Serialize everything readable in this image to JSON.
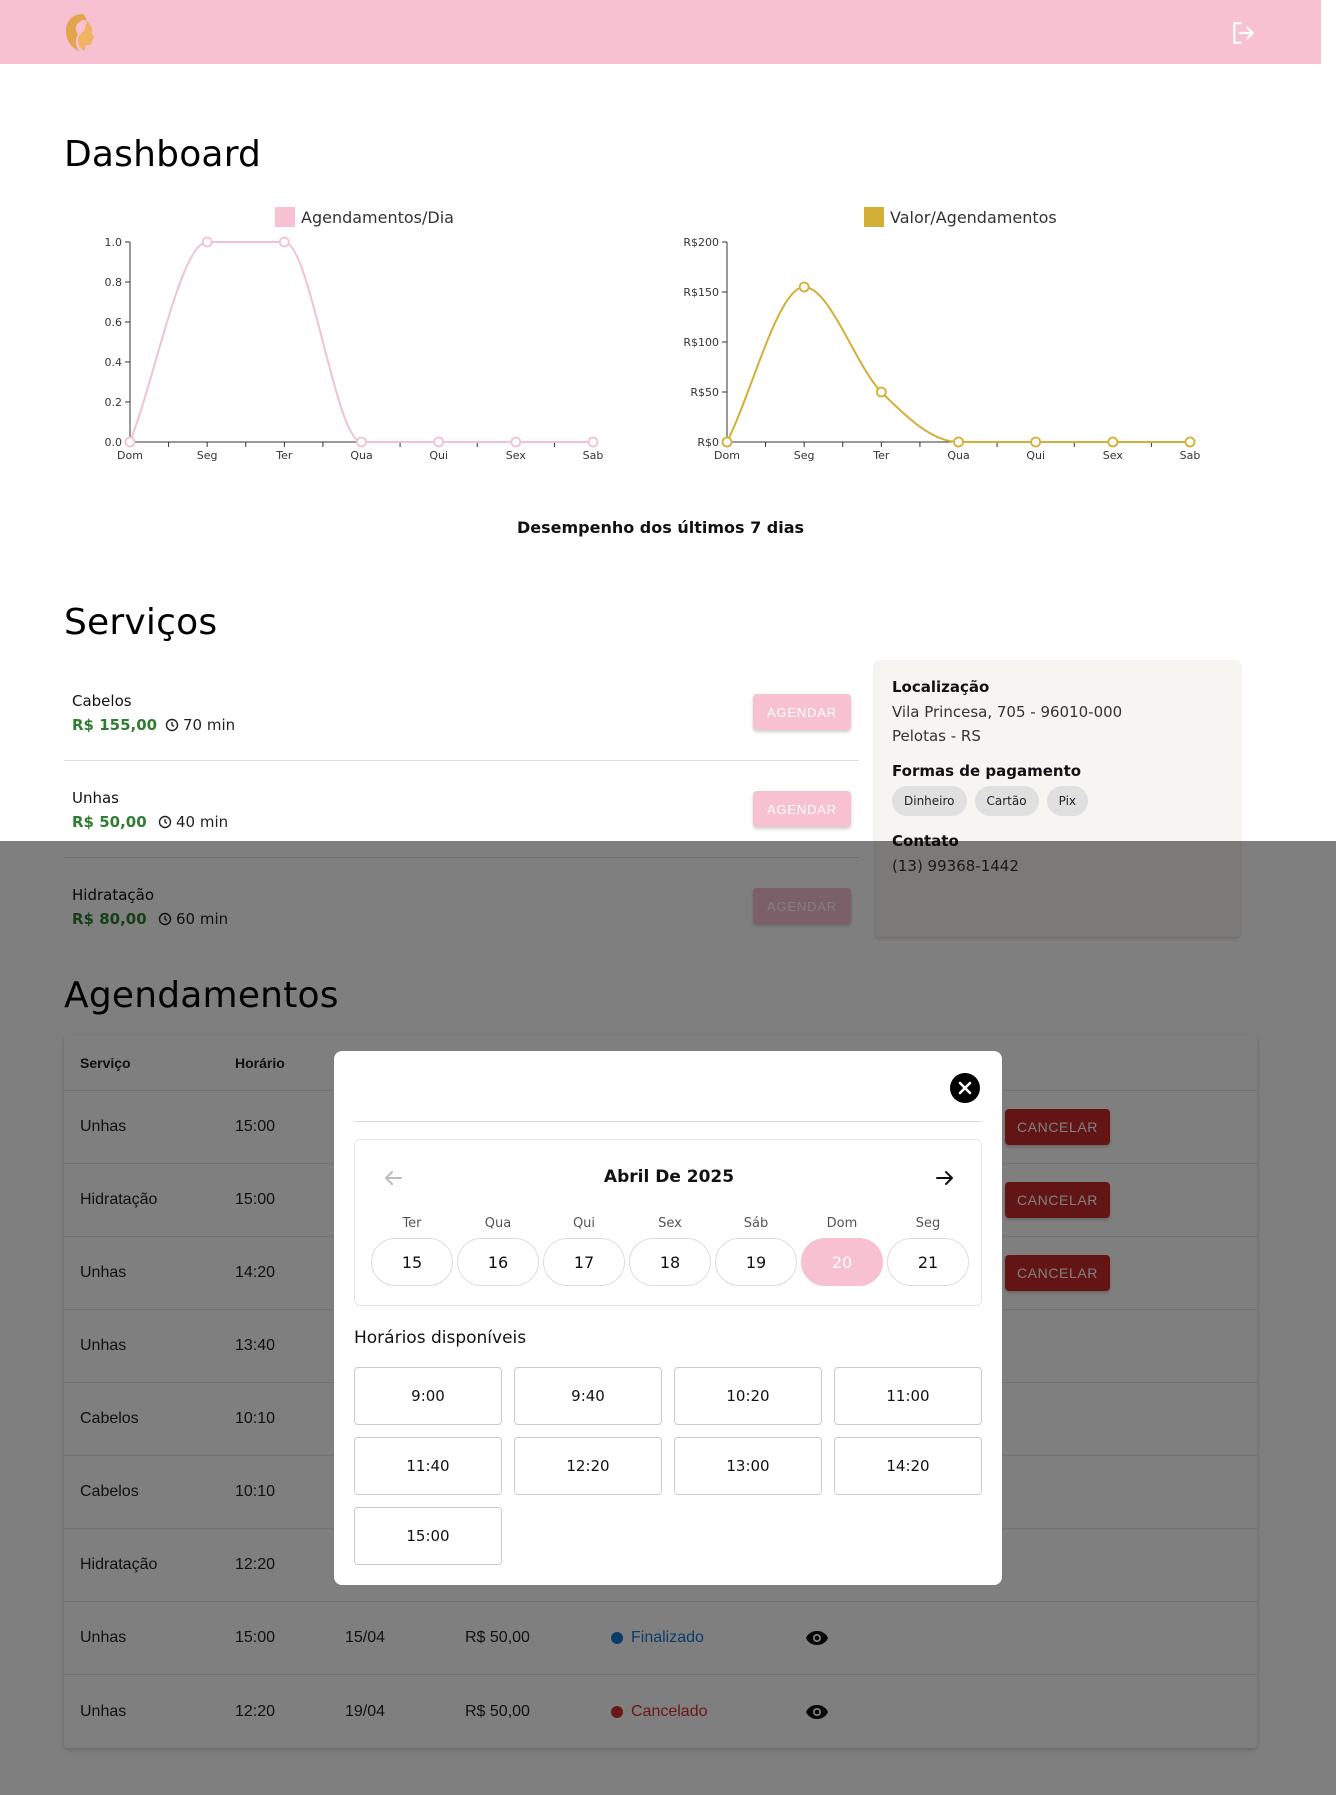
{
  "header": {
    "logo_icon": "woman-profile-logo",
    "logout_icon": "logout-icon"
  },
  "dashboard": {
    "title": "Dashboard",
    "caption": "Desempenho dos últimos 7 dias"
  },
  "chart_data": [
    {
      "type": "line",
      "categories": [
        "Dom",
        "Seg",
        "Ter",
        "Qua",
        "Qui",
        "Sex",
        "Sab"
      ],
      "series": [
        {
          "name": "Agendamentos/Dia",
          "values": [
            0,
            1,
            1,
            0,
            0,
            0,
            0
          ],
          "color": "#f2c2d3"
        }
      ],
      "ylim": [
        0,
        1
      ],
      "yticks": [
        "0.0",
        "0.2",
        "0.4",
        "0.6",
        "0.8",
        "1.0"
      ],
      "legend": "top"
    },
    {
      "type": "line",
      "categories": [
        "Dom",
        "Seg",
        "Ter",
        "Qua",
        "Qui",
        "Sex",
        "Sab"
      ],
      "series": [
        {
          "name": "Valor/Agendamentos",
          "values": [
            0,
            155,
            50,
            0,
            0,
            0,
            0
          ],
          "color": "#d4af37"
        }
      ],
      "ylim": [
        0,
        200
      ],
      "yticks": [
        "R$0",
        "R$50",
        "R$100",
        "R$150",
        "R$200"
      ],
      "legend": "top"
    }
  ],
  "services": {
    "title": "Serviços",
    "button_label": "AGENDAR",
    "items": [
      {
        "name": "Cabelos",
        "price": "R$ 155,00",
        "duration": "70 min"
      },
      {
        "name": "Unhas",
        "price": "R$ 50,00",
        "duration": "40 min"
      },
      {
        "name": "Hidratação",
        "price": "R$ 80,00",
        "duration": "60 min"
      }
    ]
  },
  "info": {
    "location_title": "Localização",
    "address_line1": "Vila Princesa, 705 - 96010-000",
    "address_line2": "Pelotas - RS",
    "payment_title": "Formas de pagamento",
    "payments": [
      "Dinheiro",
      "Cartão",
      "Pix"
    ],
    "contact_title": "Contato",
    "phone": "(13) 99368-1442"
  },
  "appointments": {
    "title": "Agendamentos",
    "headers": {
      "service": "Serviço",
      "time": "Horário"
    },
    "cancel_label": "CANCELAR",
    "rows": [
      {
        "service": "Unhas",
        "time": "15:00"
      },
      {
        "service": "Hidratação",
        "time": "15:00"
      },
      {
        "service": "Unhas",
        "time": "14:20"
      },
      {
        "service": "Unhas",
        "time": "13:40"
      },
      {
        "service": "Cabelos",
        "time": "10:10"
      },
      {
        "service": "Cabelos",
        "time": "10:10"
      },
      {
        "service": "Hidratação",
        "time": "12:20"
      },
      {
        "service": "Unhas",
        "time": "15:00",
        "date": "15/04",
        "value": "R$ 50,00",
        "status": "Finalizado",
        "status_color": "#1976d2"
      },
      {
        "service": "Unhas",
        "time": "12:20",
        "date": "19/04",
        "value": "R$ 50,00",
        "status": "Cancelado",
        "status_color": "#d32f2f"
      }
    ]
  },
  "modal": {
    "month_title": "Abril De 2025",
    "days": [
      {
        "name": "Ter",
        "num": "15"
      },
      {
        "name": "Qua",
        "num": "16"
      },
      {
        "name": "Qui",
        "num": "17"
      },
      {
        "name": "Sex",
        "num": "18"
      },
      {
        "name": "Sáb",
        "num": "19"
      },
      {
        "name": "Dom",
        "num": "20",
        "selected": true
      },
      {
        "name": "Seg",
        "num": "21"
      }
    ],
    "slots_title": "Horários disponíveis",
    "slots": [
      "9:00",
      "9:40",
      "10:20",
      "11:00",
      "11:40",
      "12:20",
      "13:00",
      "14:20",
      "15:00"
    ]
  },
  "colors": {
    "brand_pink": "#f7c1d2",
    "price_green": "#2e7d32",
    "cancel_red": "#c62828",
    "gold": "#d4af37"
  }
}
